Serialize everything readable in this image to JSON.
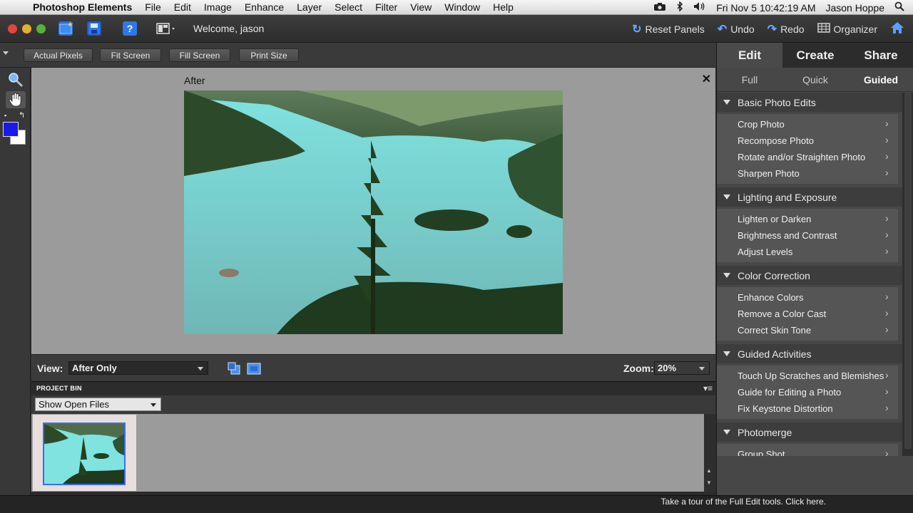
{
  "menubar": {
    "app_name": "Photoshop Elements",
    "items": [
      "File",
      "Edit",
      "Image",
      "Enhance",
      "Layer",
      "Select",
      "Filter",
      "View",
      "Window",
      "Help"
    ],
    "clock": "Fri Nov 5  10:42:19 AM",
    "user": "Jason Hoppe"
  },
  "apptoolbar": {
    "welcome": "Welcome, jason",
    "reset_panels": "Reset Panels",
    "undo": "Undo",
    "redo": "Redo",
    "organizer": "Organizer"
  },
  "options": {
    "actual_pixels": "Actual Pixels",
    "fit_screen": "Fit Screen",
    "fill_screen": "Fill Screen",
    "print_size": "Print Size"
  },
  "canvas": {
    "label": "After"
  },
  "viewbar": {
    "view_label": "View:",
    "view_value": "After Only",
    "zoom_label": "Zoom:",
    "zoom_value": "20%"
  },
  "bin": {
    "title": "PROJECT BIN",
    "show_value": "Show Open Files"
  },
  "panel": {
    "modes": [
      "Edit",
      "Create",
      "Share"
    ],
    "subtabs": [
      "Full",
      "Quick",
      "Guided"
    ],
    "sections": [
      {
        "title": "Basic Photo Edits",
        "items": [
          "Crop Photo",
          "Recompose Photo",
          "Rotate and/or Straighten Photo",
          "Sharpen Photo"
        ]
      },
      {
        "title": "Lighting and Exposure",
        "items": [
          "Lighten or Darken",
          "Brightness and Contrast",
          "Adjust Levels"
        ]
      },
      {
        "title": "Color Correction",
        "items": [
          "Enhance Colors",
          "Remove a Color Cast",
          "Correct Skin Tone"
        ]
      },
      {
        "title": "Guided Activities",
        "items": [
          "Touch Up Scratches and Blemishes",
          "Guide for Editing a Photo",
          "Fix Keystone Distortion"
        ]
      },
      {
        "title": "Photomerge",
        "items": [
          "Group Shot"
        ]
      }
    ]
  },
  "status": {
    "tour": "Take a tour of the Full Edit tools. Click here."
  },
  "colors": {
    "foreground": "#1a1ae6",
    "background": "#ffffff",
    "accent": "#3a6df0"
  }
}
